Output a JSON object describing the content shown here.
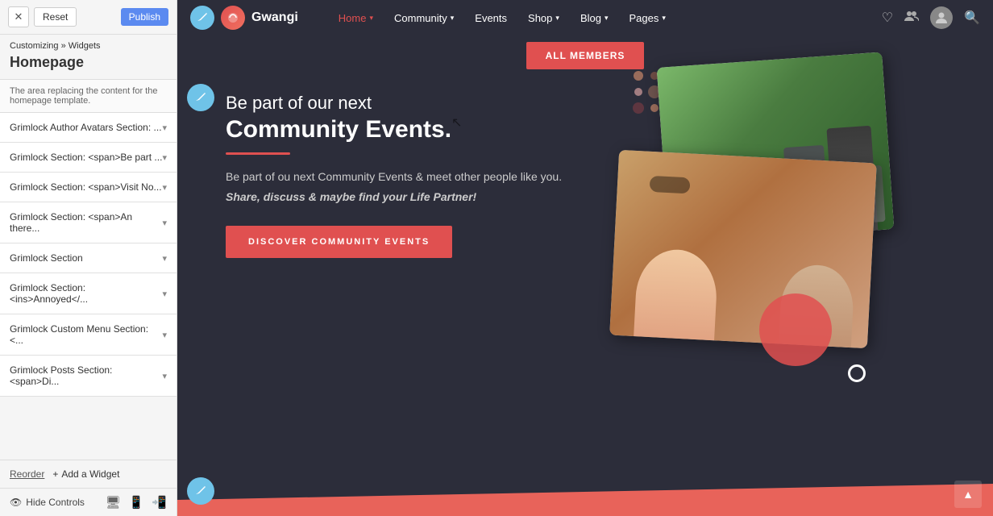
{
  "sidebar": {
    "close_label": "✕",
    "reset_label": "Reset",
    "publish_label": "Publish",
    "breadcrumb_parent": "Customizing",
    "breadcrumb_separator": " » ",
    "breadcrumb_child": "Widgets",
    "page_title": "Homepage",
    "info_text": "The area replacing the content for the homepage template.",
    "widgets": [
      {
        "label": "Grimlock Author Avatars Section: ..."
      },
      {
        "label": "Grimlock Section: <span>Be part ..."
      },
      {
        "label": "Grimlock Section: <span>Visit No..."
      },
      {
        "label": "Grimlock Section: <span>An there..."
      },
      {
        "label": "Grimlock Section"
      },
      {
        "label": "Grimlock Section: <ins>Annoyed</..."
      },
      {
        "label": "Grimlock Custom Menu Section: <..."
      },
      {
        "label": "Grimlock Posts Section: <span>Di..."
      }
    ],
    "reorder_label": "Reorder",
    "add_widget_label": "Add a Widget",
    "hide_controls_label": "Hide Controls"
  },
  "nav": {
    "site_name": "Gwangi",
    "menu_items": [
      {
        "label": "Home",
        "has_arrow": true,
        "active": true
      },
      {
        "label": "Community",
        "has_arrow": true,
        "active": false
      },
      {
        "label": "Events",
        "has_arrow": false,
        "active": false
      },
      {
        "label": "Shop",
        "has_arrow": true,
        "active": false
      },
      {
        "label": "Blog",
        "has_arrow": true,
        "active": false
      },
      {
        "label": "Pages",
        "has_arrow": true,
        "active": false
      }
    ]
  },
  "hero": {
    "all_members_btn": "ALL MEMBERS",
    "subtitle": "Be part of our next",
    "title": "Community Events.",
    "description": "Be part of ou next Community Events & meet other people like you.",
    "tagline": "Share, discuss & maybe find your Life Partner!",
    "discover_btn": "DISCOVER COMMUNITY EVENTS"
  },
  "decorations": {
    "edit_pencil": "✏",
    "back_to_top": "▲"
  }
}
